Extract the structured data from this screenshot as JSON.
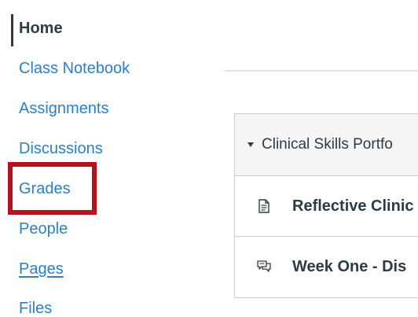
{
  "course_nav": {
    "items": [
      {
        "label": "Home"
      },
      {
        "label": "Class Notebook"
      },
      {
        "label": "Assignments"
      },
      {
        "label": "Discussions"
      },
      {
        "label": "Grades"
      },
      {
        "label": "People"
      },
      {
        "label": "Pages"
      },
      {
        "label": "Files"
      }
    ]
  },
  "modules": {
    "header": {
      "title": "Clinical Skills Portfo",
      "icon": "caret-down-icon"
    },
    "items": [
      {
        "title": "Reflective Clinic",
        "icon": "document-icon"
      },
      {
        "title": "Week One - Dis",
        "icon": "discussion-icon"
      }
    ]
  },
  "colors": {
    "link": "#2d7fc3",
    "text": "#2d3b45",
    "highlight": "#b5121b",
    "border": "#c7cdd1",
    "header_bg": "#f5f5f5"
  }
}
